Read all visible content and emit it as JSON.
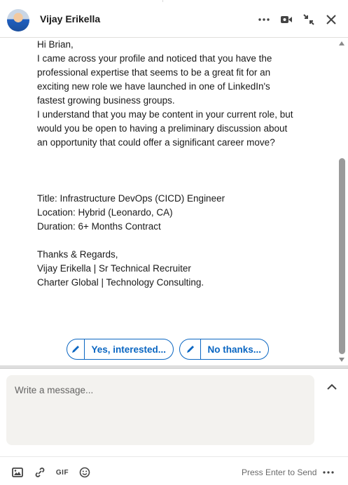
{
  "header": {
    "name": "Vijay Erikella",
    "icons": [
      "more-icon",
      "video-icon",
      "minimize-icon",
      "close-icon"
    ]
  },
  "message": {
    "greeting": "Hi Brian,",
    "para1": "I came across your profile and noticed that you have the professional expertise that seems to be a great fit for an exciting new role we have launched in one of LinkedIn's fastest growing business groups.",
    "para2": "I understand that you may be content in your current role, but would you be open to having a preliminary discussion about an opportunity that could offer a significant career move?",
    "title": "Title: Infrastructure DevOps (CICD) Engineer",
    "location": "Location: Hybrid (Leonardo, CA)",
    "duration": "Duration: 6+ Months Contract",
    "signoff": "Thanks & Regards,",
    "signature1": "Vijay Erikella | Sr Technical Recruiter",
    "signature2": "Charter Global | Technology Consulting."
  },
  "quick_replies": [
    {
      "label": "Yes, interested..."
    },
    {
      "label": "No thanks..."
    }
  ],
  "compose": {
    "placeholder": "Write a message...",
    "value": ""
  },
  "footer": {
    "gif_label": "GIF",
    "send_hint": "Press Enter to Send"
  },
  "colors": {
    "accent": "#0a66c2",
    "compose_bg": "#f3f2ef"
  }
}
